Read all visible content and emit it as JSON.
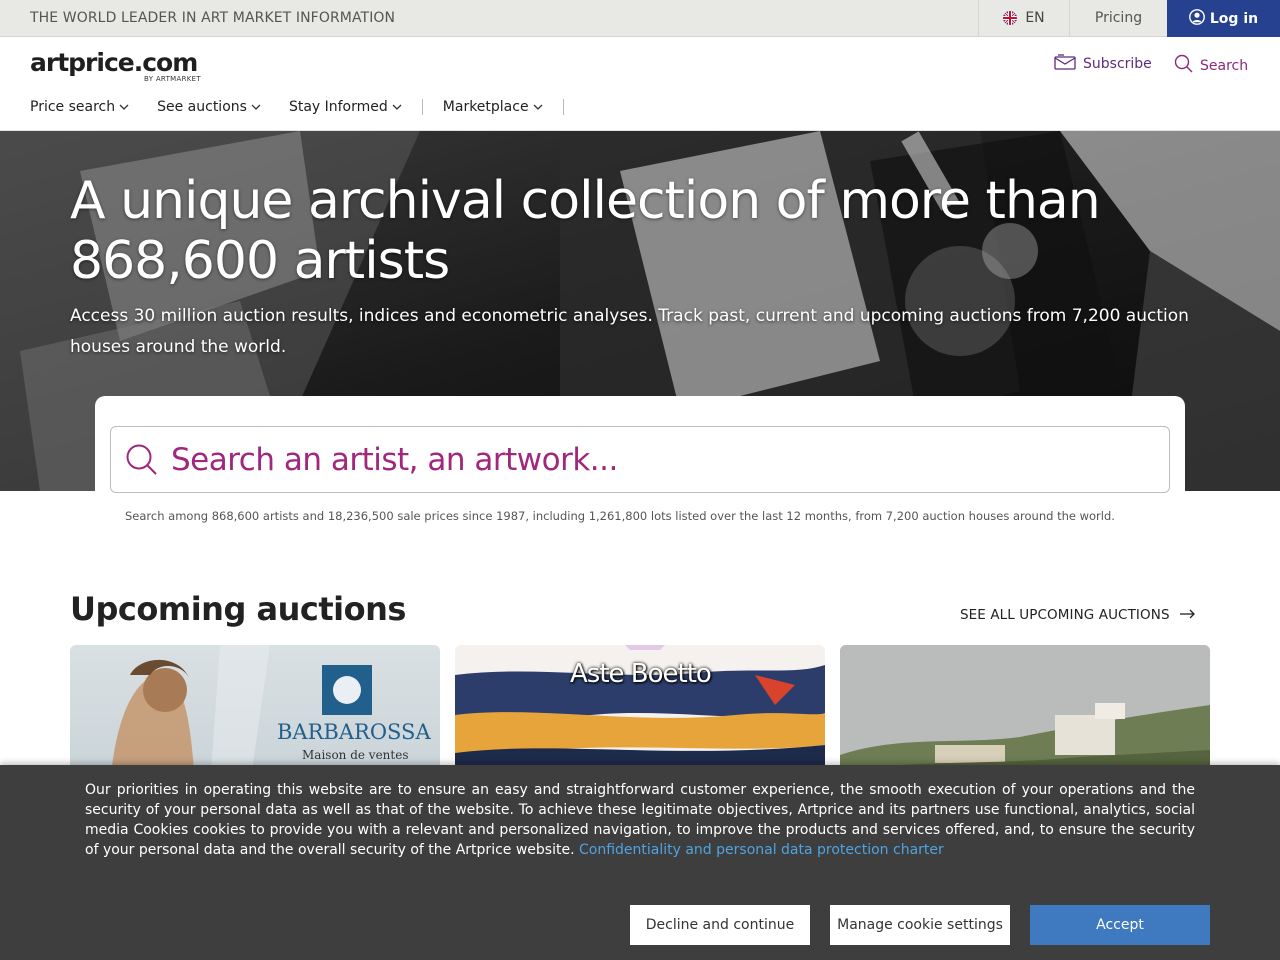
{
  "topbar": {
    "tagline": "THE WORLD LEADER IN ART MARKET INFORMATION",
    "language": "EN",
    "pricing": "Pricing",
    "login": "Log in"
  },
  "header": {
    "logo": "artprice.com",
    "logo_sub": "BY ARTMARKET",
    "subscribe": "Subscribe",
    "search": "Search",
    "nav": [
      {
        "label": "Price search"
      },
      {
        "label": "See auctions"
      },
      {
        "label": "Stay Informed"
      },
      {
        "label": "Marketplace"
      }
    ]
  },
  "hero": {
    "title": "A unique archival collection of more than 868,600 artists",
    "subtitle": "Access 30 million auction results, indices and econometric analyses. Track past, current and upcoming auctions from 7,200 auction houses around the world."
  },
  "search": {
    "placeholder": "Search an artist, an artwork...",
    "hint": "Search among 868,600 artists and 18,236,500 sale prices since 1987, including 1,261,800 lots listed over the last 12 months, from 7,200 auction houses around the world."
  },
  "upcoming": {
    "title": "Upcoming auctions",
    "see_all": "SEE ALL UPCOMING AUCTIONS",
    "cards": [
      {
        "brand": "BARBAROSSA",
        "brand_sub": "Maison de ventes"
      },
      {
        "brand": "Aste Boetto"
      },
      {
        "brand": ""
      }
    ]
  },
  "cookie": {
    "text": "Our priorities in operating this website are to ensure an easy and straightforward customer experience, the smooth execution of your operations and the security of your personal data as well as that of the website. To achieve these legitimate objectives, Artprice and its partners use functional, analytics, social media Cookies cookies to provide you with a relevant and personalized navigation, to improve the products and services offered, and, to ensure the security of your personal data and the overall security of the Artprice website.",
    "link": "Confidentiality and personal data protection charter",
    "decline": "Decline and continue",
    "manage": "Manage cookie settings",
    "accept": "Accept"
  },
  "colors": {
    "login_bg": "#26418f",
    "brand_purple": "#a1277d",
    "accept_bg": "#3f79bf",
    "cookie_bg": "#3e3e3e"
  }
}
